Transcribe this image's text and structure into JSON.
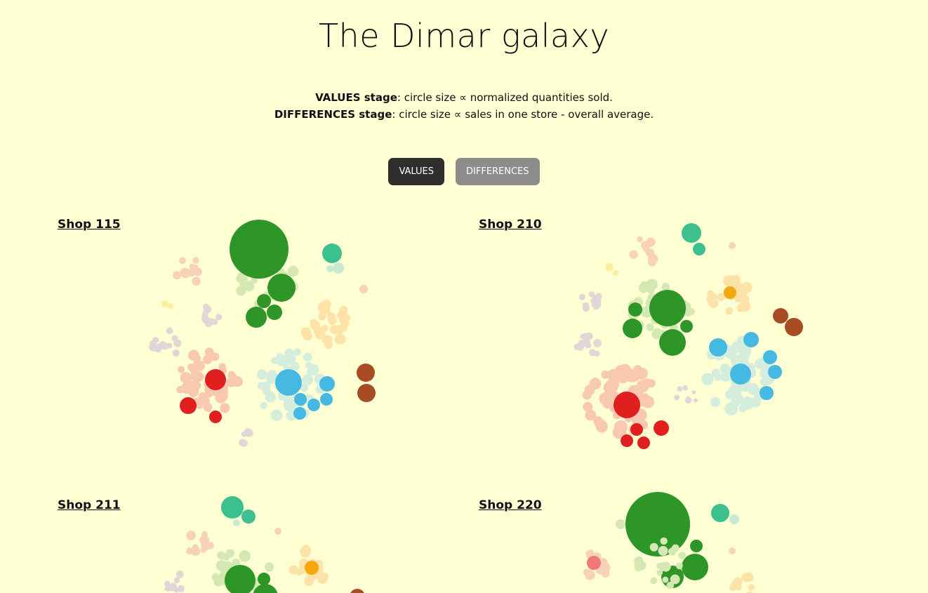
{
  "page": {
    "title": "The Dimar galaxy",
    "values_stage_label": "VALUES stage",
    "values_stage_text": ": circle size ∝ normalized quantities sold.",
    "differences_stage_label": "DIFFERENCES stage",
    "differences_stage_text": ": circle size ∝ sales in one store - overall average."
  },
  "buttons": {
    "values": "VALUES",
    "differences": "DIFFERENCES",
    "active": "values"
  },
  "colors": {
    "background": "#ffffd4",
    "green": "#2e9627",
    "red": "#e0201e",
    "blue": "#46b9e2",
    "teal": "#3cc08e",
    "brown": "#a84c24",
    "orange": "#f4a80c"
  },
  "shops": [
    {
      "name": "Shop 115"
    },
    {
      "name": "Shop 210"
    },
    {
      "name": "Shop 211"
    },
    {
      "name": "Shop 220"
    }
  ]
}
